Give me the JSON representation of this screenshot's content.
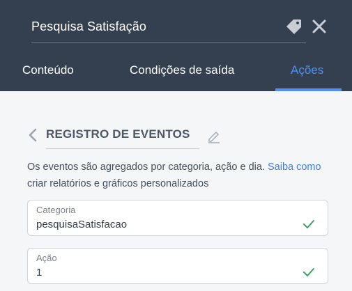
{
  "header": {
    "title": "Pesquisa Satisfação",
    "icons": {
      "tag": "tag-icon",
      "close": "close-icon"
    },
    "bg_color": "#34404f"
  },
  "tabs": [
    {
      "label": "Conteúdo",
      "active": false
    },
    {
      "label": "Condições de saída",
      "active": false
    },
    {
      "label": "Ações",
      "active": true
    }
  ],
  "accent_color": "#4f8ff7",
  "section": {
    "title": "REGISTRO DE EVENTOS",
    "description_prefix": "Os eventos são agregados por categoria, ação e dia. ",
    "description_link": "Saiba como",
    "description_suffix": " criar relatórios e gráficos personalizados"
  },
  "fields": {
    "categoria": {
      "label": "Categoria",
      "value": "pesquisaSatisfacao",
      "valid": true
    },
    "acao": {
      "label": "Ação",
      "value": "1",
      "valid": true
    }
  },
  "valid_color": "#3aa35f"
}
